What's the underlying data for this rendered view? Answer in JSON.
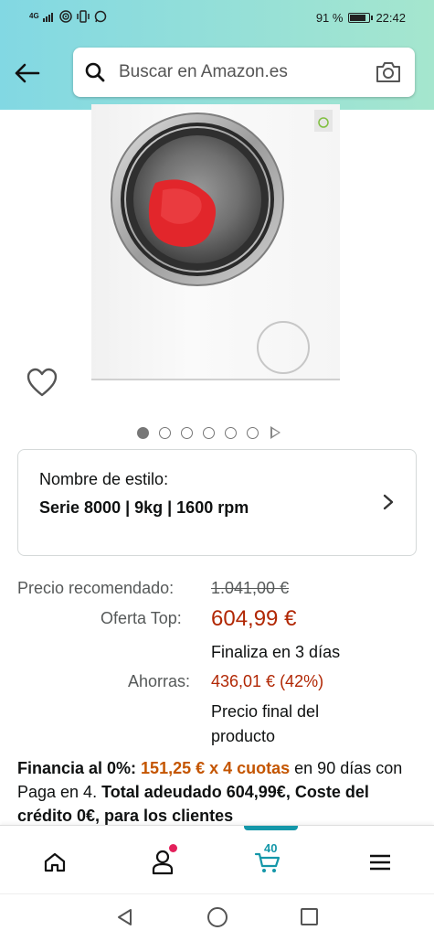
{
  "status_bar": {
    "network": "4G",
    "battery_text": "91 %",
    "battery_level": 0.91,
    "time": "22:42"
  },
  "header": {
    "search_placeholder": "Buscar en Amazon.es",
    "background_colors": [
      "#82d8e3",
      "#a5e6ce"
    ]
  },
  "carousel": {
    "image_count": 6,
    "active_index": 0,
    "has_video": true
  },
  "style_selector": {
    "label": "Nombre de estilo:",
    "value": "Serie 8000 | 9kg | 1600 rpm"
  },
  "price": {
    "recommended_label": "Precio recomendado:",
    "recommended_value": "1.041,00 €",
    "offer_label": "Oferta Top:",
    "offer_value": "604,99 €",
    "offer_ends": "Finaliza en 3 días",
    "savings_label": "Ahorras:",
    "savings_value": "436,01 € (42%)",
    "final_note": "Precio final del producto"
  },
  "financing": {
    "prefix": "Financia al 0%: ",
    "installments": "151,25 € x 4 cuotas",
    "middle": " en 90 días con Paga en 4. ",
    "total": "Total adeudado 604,99€, Coste del crédito 0€, para los clientes"
  },
  "bottom_nav": {
    "cart_count": "40",
    "accent_color": "#1497a9",
    "notification_color": "#e3205b"
  },
  "colors": {
    "price_red": "#b12704",
    "financing_orange": "#c45500"
  }
}
